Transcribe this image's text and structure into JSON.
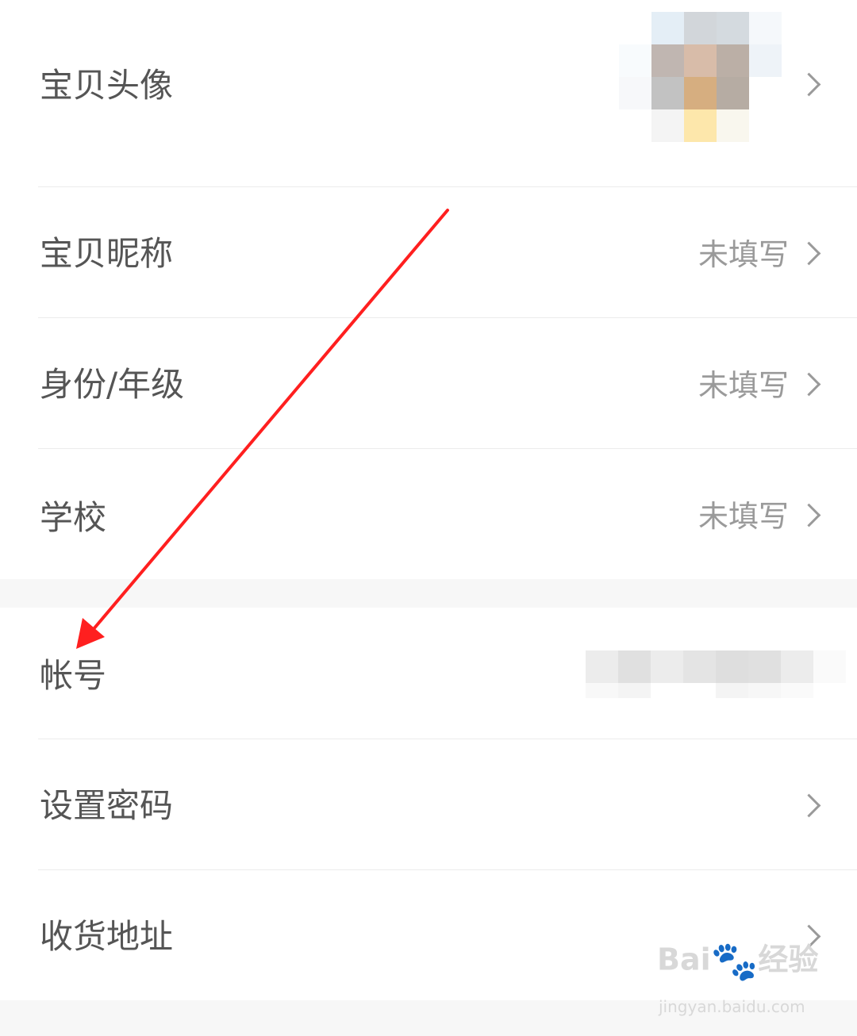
{
  "rows": {
    "avatar": {
      "label": "宝贝头像"
    },
    "nickname": {
      "label": "宝贝昵称",
      "value": "未填写"
    },
    "identity": {
      "label": "身份/年级",
      "value": "未填写"
    },
    "school": {
      "label": "学校",
      "value": "未填写"
    },
    "account": {
      "label": "帐号"
    },
    "password": {
      "label": "设置密码"
    },
    "address": {
      "label": "收货地址"
    }
  },
  "watermark": {
    "brand": "Bai",
    "brand_suffix": "经验",
    "url": "jingyan.baidu.com"
  },
  "colors": {
    "label": "#555555",
    "value": "#9a9a9a",
    "annotation_arrow": "#ff1f1f",
    "section_gap": "#f7f7f7"
  },
  "icons": [
    "chevron-right-icon",
    "annotation-arrow",
    "baidu-paw-icon"
  ]
}
